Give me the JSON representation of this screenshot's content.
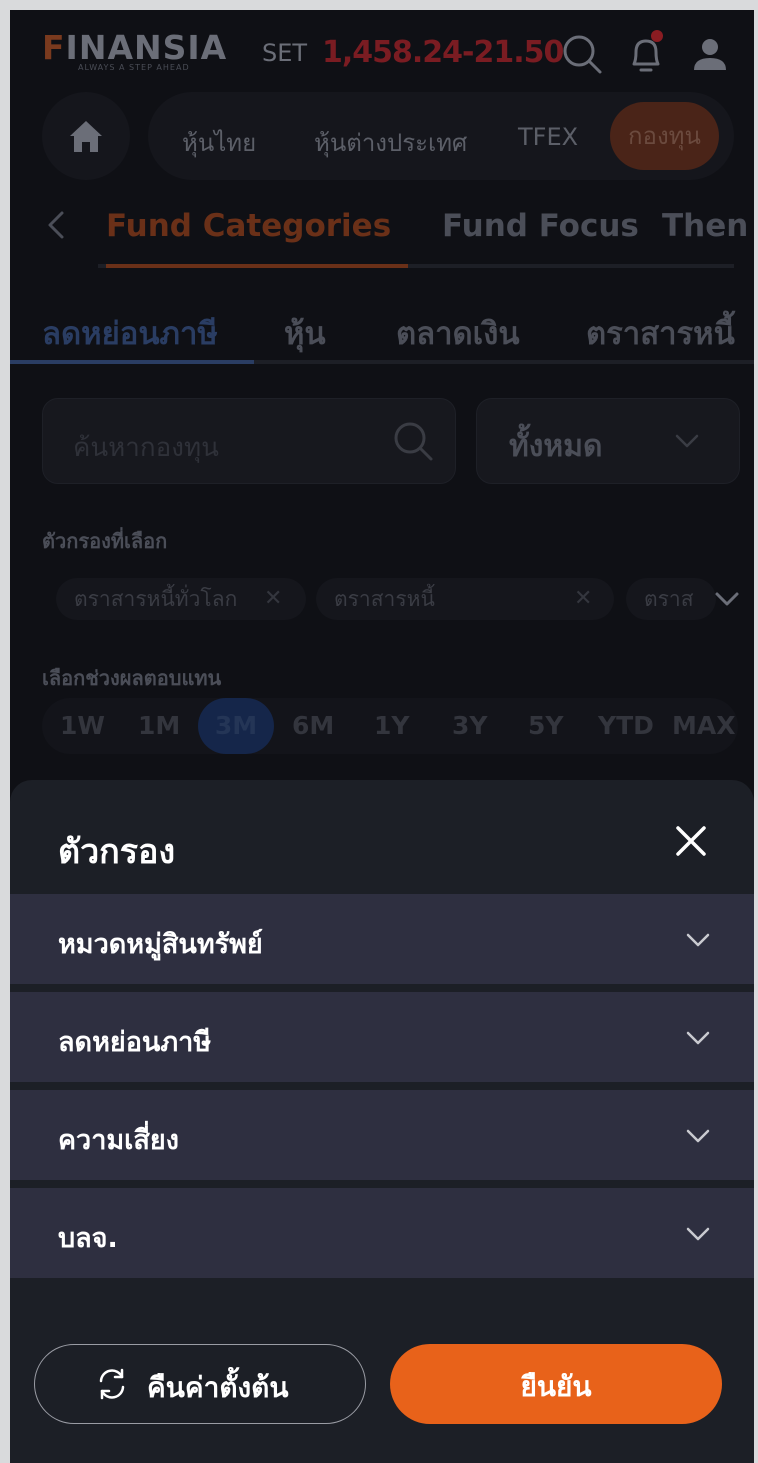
{
  "header": {
    "logo_text": "INANSIA",
    "logo_f": "F",
    "tagline": "ALWAYS A STEP AHEAD",
    "index_label": "SET",
    "index_value": "1,458.24",
    "index_change": "-21.50"
  },
  "nav": {
    "items": [
      "หุ้นไทย",
      "หุ้นต่างประเทศ",
      "TFEX",
      "กองทุน"
    ],
    "active": "กองทุน"
  },
  "subtabs": [
    "Fund Categories",
    "Fund Focus",
    "Then"
  ],
  "category_tabs": [
    "ลดหย่อนภาษี",
    "หุ้น",
    "ตลาดเงิน",
    "ตราสารหนี้"
  ],
  "search": {
    "placeholder": "ค้นหากองทุน"
  },
  "select": {
    "value": "ทั้งหมด"
  },
  "selected_filters": {
    "label": "ตัวกรองที่เลือก",
    "chips": [
      "ตราสารหนี้ทั่วโลก",
      "ตราสารหนี้",
      "ตราส"
    ]
  },
  "periods": {
    "label": "เลือกช่วงผลตอบแทน",
    "items": [
      "1W",
      "1M",
      "3M",
      "6M",
      "1Y",
      "3Y",
      "5Y",
      "YTD",
      "MAX"
    ],
    "active": "3M"
  },
  "sheet": {
    "title": "ตัวกรอง",
    "sections": [
      "หมวดหมู่สินทรัพย์",
      "ลดหย่อนภาษี",
      "ความเสี่ยง",
      "บลจ."
    ],
    "reset_label": "คืนค่าตั้งต้น",
    "confirm_label": "ยืนยัน"
  },
  "colors": {
    "accent_orange": "#e8621a",
    "sheet_bg": "#1c1f26",
    "accordion_bg": "#2e2f40"
  }
}
